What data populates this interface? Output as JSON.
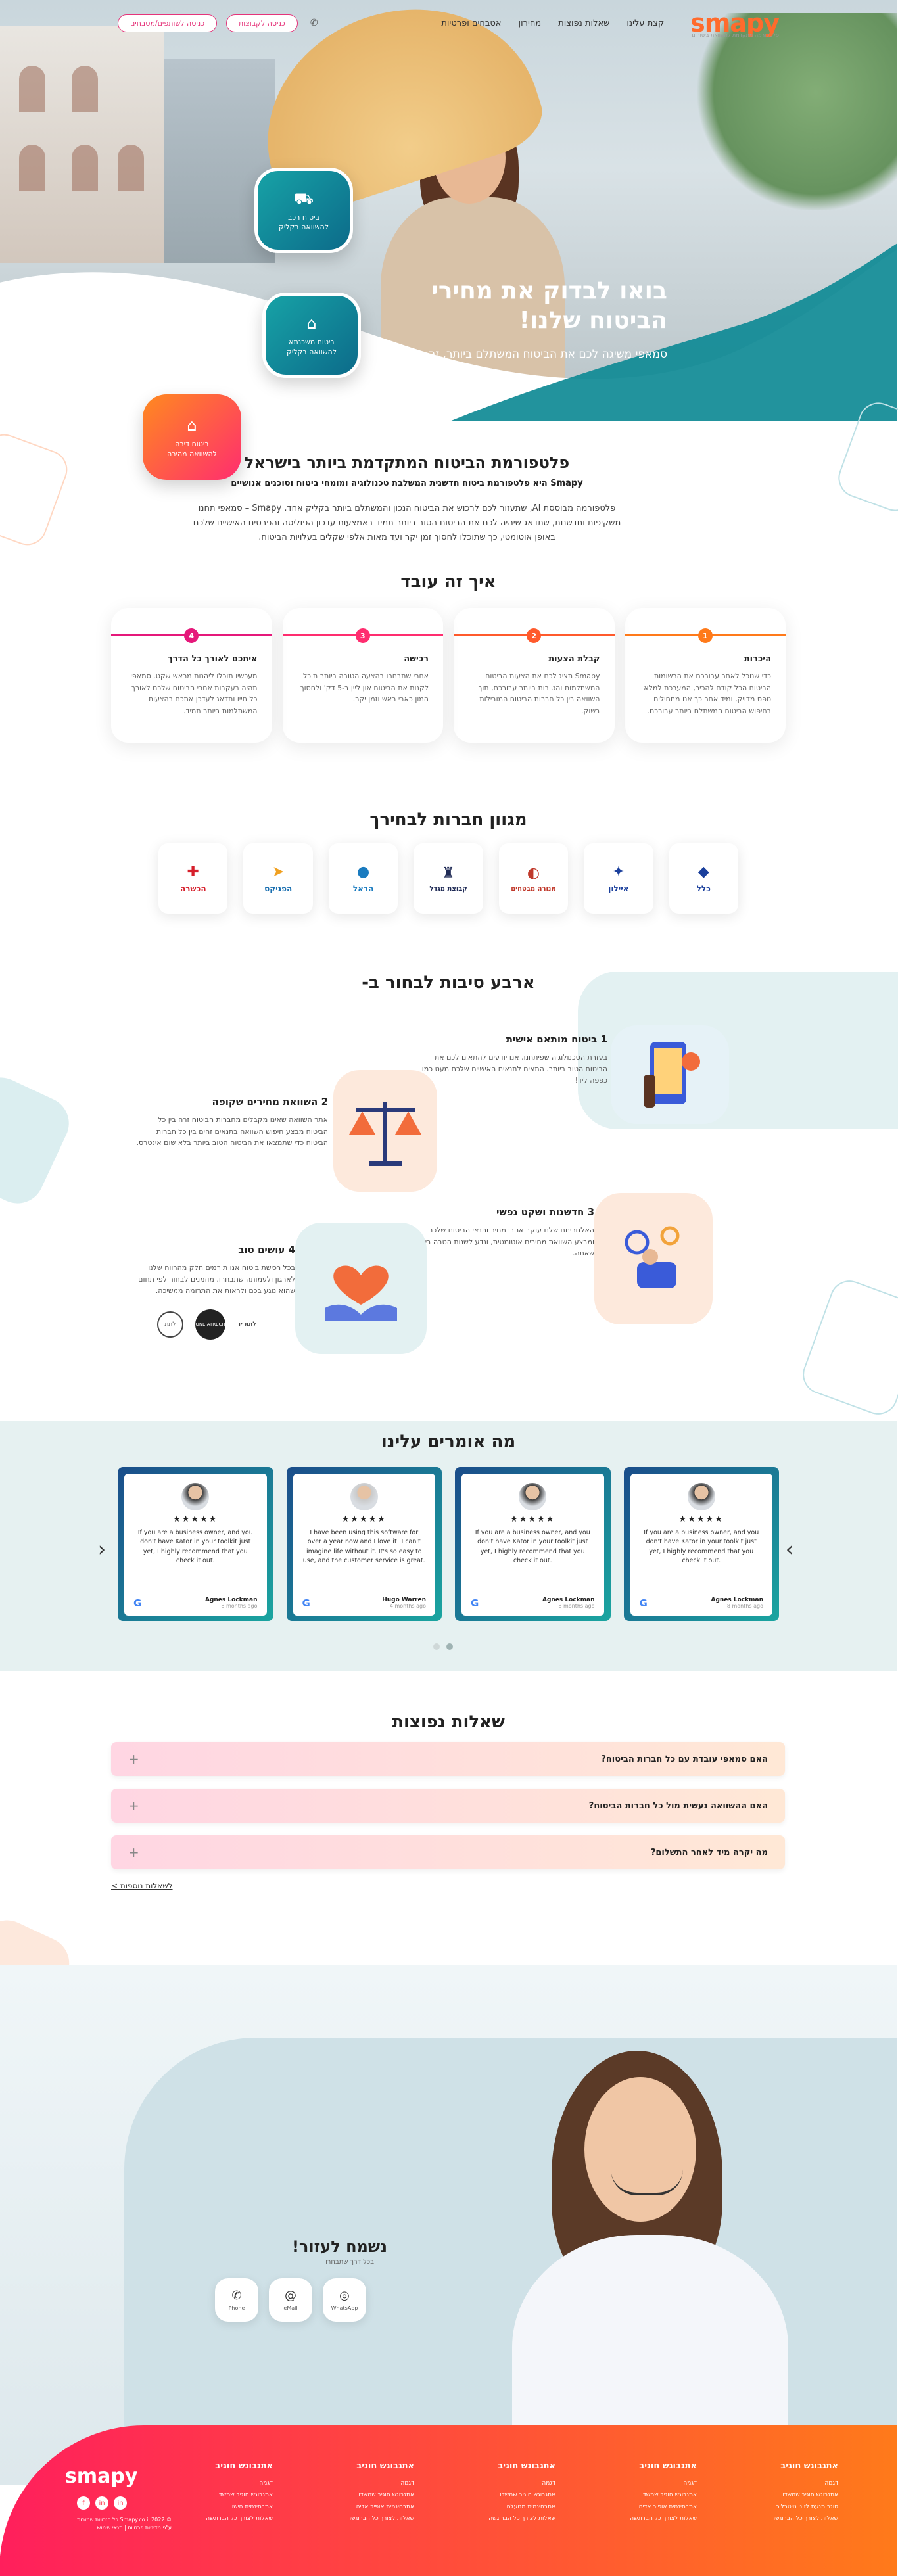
{
  "header": {
    "logo": "smapy",
    "logo_sub": "פלטפורמה מתקדמת להשוואת ביטוחים",
    "nav": [
      "קצת עלינו",
      "שאלות נפוצות",
      "מחירון",
      "אטבחים ופרטיות"
    ],
    "btn_login": "כניסה לקבוצות",
    "btn_signup": "כניסה לשותפים/מטבחים"
  },
  "hero": {
    "title": "בואו לבדוק את מחירי הביטוח שלנו!",
    "subtitle": "סמאפי משיגה לכם את הביטוח המשתלם ביותר, זה בדוק!",
    "card1": "ביטוח רכב\nלהשוואה בקליק",
    "card2": "ביטוח משכנתא\nלהשוואה בקליק",
    "card3": "ביטוח דירה\nלהשוואה מהירה"
  },
  "intro": {
    "title": "פלטפורמת הביטוח המתקדמת ביותר בישראל",
    "lead": "Smapy היא פלטפורמת ביטוח חדשנית המשלבת טכנולוגיה ומומחי ביטוח וסוכנים אנושיים",
    "body": "פלטפורמה מבוססת AI, שתעזור לכם לרכוש את הביטוח הנכון והמשתלם ביותר בקליק אחד. Smapy – סמאפי תחנו משקיפות וחדשנות, שתדאג שיהיה לכם את הביטוח הטוב ביותר תמיד באמצעות עדכון הפוליסה והפרטים האישיים שלכם באופן אוטומטי, כך שתוכלו לחסוך זמן יקר ועד מאות אלפי שקלים בעלויות הביטוח."
  },
  "how": {
    "title": "איך זה עובד",
    "steps": [
      {
        "num": "1",
        "title": "היכרות",
        "text": "כדי שנוכל לאחר עבורכם את הרשומות הביטוח הכל קודם להכיר, המערכת למלא טפס מדויק, ומיד אחר כך אנו מתחילים בחיפוש הביטוח המשתלם ביותר עבורכם.",
        "color": "#ff7a1a"
      },
      {
        "num": "2",
        "title": "קבלת הצעות",
        "text": "Smapy תציג לכם את הצעות הביטוח המשתלמות והטובות ביותר עבורכם, תוך השוואה בין כל חברות הביטוח המובילות בשוק.",
        "color": "#ff5a2c"
      },
      {
        "num": "3",
        "title": "רכישה",
        "text": "אחרי שתבחרו בהצעה הטובה ביותר תוכלו לקנות את הביטוח און ליין ב-5 דק' ולחסוך המון כאבי ראש וזמן יקר.",
        "color": "#ff2d6f"
      },
      {
        "num": "4",
        "title": "איתכם לאורך כל הדרך",
        "text": "מעכשיו תוכלו ליהנות מראש שקט. סמאפי תהיה בעקבות אחרי הביטוח שלכם לאורך כל חייו ותדאג לעדכן אתכם בהצעות המשתלמות ביותר תמיד.",
        "color": "#e5187a"
      }
    ]
  },
  "companies": {
    "title": "מגוון חברות לבחירך",
    "items": [
      {
        "name": "כלל",
        "icon": "◆",
        "color": "#1a3f9c"
      },
      {
        "name": "איילון",
        "icon": "✦",
        "color": "#1a3f9c"
      },
      {
        "name": "מנורה מבטחים",
        "icon": "◐",
        "color": "#c0392b"
      },
      {
        "name": "קבוצת מגדל",
        "icon": "♜",
        "color": "#1f2a55"
      },
      {
        "name": "הראל",
        "icon": "●",
        "color": "#1a7bbf"
      },
      {
        "name": "הפניקס",
        "icon": "➤",
        "color": "#1a6fb0"
      },
      {
        "name": "הכשרה",
        "icon": "✚",
        "color": "#d61f2b"
      }
    ]
  },
  "reasons": {
    "title": "ארבע סיבות לבחור ב-",
    "r1_title": "1  ביטוח מותאם אישית",
    "r1_text": "בעזרת הטכנולוגיה שפיתחנו, אנו יודעים להתאים לכם את הביטוח הטוב ביותר. התאים לתנאים האישיים שלכם מעט כמו כפפה ליד!",
    "r2_title": "2  השוואת מחירים שקופה",
    "r2_text": "אתר השוואה שאינו מקבלים מחברות הביטוח זרה בין כל הביטוח מבצע חיפוש השוואה בתנאים זהים בין כל חברות הביטוח כדי שתמצאו את הביטוח הטוב ביותר בלא שום אינטרס.",
    "r3_title": "3  חדשנות ושקט נפשי",
    "r3_text": "האלגוריתם שלנו עוקב אחרי מחיר ותנאי הביטוח שלכם ומבצע השוואת מחירים אוטומטית, ונדע לשנות הטבה ביותר שאתה.",
    "r4_title": "4  עושים טוב",
    "r4_text": "בכל רכישת ביטוח אנו תורמים חלק מהרווח שלנו לארגון ולעמותה שתבחרו. מוזמנים לבחור לפי תחום שהוא נוגע בכם ולראות את התרומה ממשיכה.",
    "charity": [
      "לתת",
      "ONE ATRECH",
      "לתת יד"
    ]
  },
  "testimonials": {
    "title": "מה אומרים עלינו",
    "stars": "★★★★★",
    "items": [
      {
        "text": "If you are a business owner, and you don't have Kator in your toolkit just yet, I highly recommend that you check it out.",
        "name": "Agnes Lockman",
        "time": "8 months ago"
      },
      {
        "text": "I have been using this software for over a year now and I love it! I can't imagine life without it. It's so easy to use, and the customer service is great.",
        "name": "Hugo Warren",
        "time": "4 months ago"
      },
      {
        "text": "If you are a business owner, and you don't have Kator in your toolkit just yet, I highly recommend that you check it out.",
        "name": "Agnes Lockman",
        "time": "8 months ago"
      },
      {
        "text": "If you are a business owner, and you don't have Kator in your toolkit just yet, I highly recommend that you check it out.",
        "name": "Agnes Lockman",
        "time": "8 months ago"
      }
    ]
  },
  "faq": {
    "title": "שאלות נפוצות",
    "items": [
      "האם סמאפי עובדת עם כל חברות הביטוח?",
      "האם ההשוואה נעשית מול כל חברות הביטוח?",
      "מה יקרה מיד לאחר התשלום?"
    ],
    "more": "לשאלות נוספות >"
  },
  "help": {
    "title": "נשמח לעזור!",
    "subtitle": "בכל דרך שתבחרו",
    "buttons": [
      {
        "label": "WhatsApp",
        "icon": "◎"
      },
      {
        "label": "eMail",
        "icon": "@"
      },
      {
        "label": "Phone",
        "icon": "✆"
      }
    ]
  },
  "footer": {
    "logo": "smapy",
    "social": [
      "in",
      "in",
      "f"
    ],
    "copyright": "© Smapy.co.il 2022 כל הזכויות שמורות\nע\"פ מדיניות פרטיות | תנאי שימוש",
    "columns": [
      {
        "title": "אתגבוגש חוגיב",
        "links": [
          "דגמה",
          "אתגבוגש חוגיב שמשדו",
          "סוגר מנעת לזוני נויטרליר",
          "שאלות לצורך כל הברוגשה"
        ]
      },
      {
        "title": "אתגבוגש חוגיב",
        "links": [
          "דגמה",
          "אתגבוגש חוגיב שמשדו",
          "אתבחינמית אופיר אדיה",
          "שאלות לצורך כל הברוגשה"
        ]
      },
      {
        "title": "אתגבוגש חוגיב",
        "links": [
          "דגמה",
          "אתגבוגש חוגיב שמשדו",
          "אתבחינמית מנועלם",
          "שאלות לצורך כל הברוגשה"
        ]
      },
      {
        "title": "אתגבוגש חוגיב",
        "links": [
          "דגמה",
          "אתגבוגש חוגיב שמשדו",
          "אתבחינמית אופיר אדיה",
          "שאלות לצורך כל הברוגשה"
        ]
      },
      {
        "title": "אתגבוגש חוגיב",
        "links": [
          "דגמה",
          "אתגבוגש חוגיב שמשדו",
          "אתבחינמית חישו",
          "שאלות לצורך כל הברוגשה"
        ]
      }
    ]
  },
  "colors": {
    "brand_orange": "#ff7a1a",
    "brand_pink": "#ff1f5c",
    "teal": "#17a2a6"
  }
}
